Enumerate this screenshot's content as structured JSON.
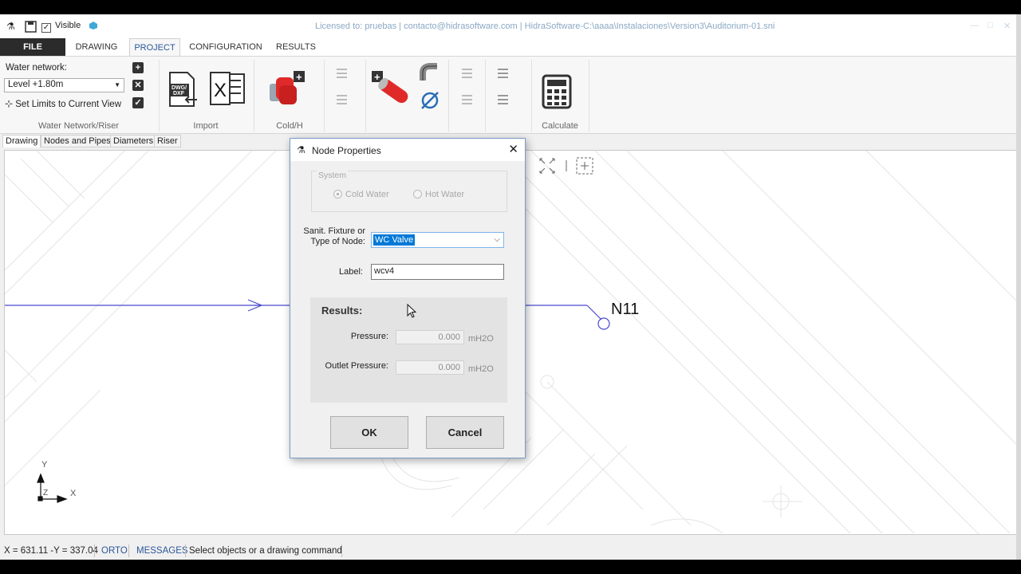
{
  "quick_access": {
    "visible_label": "Visible"
  },
  "window_title": "Licensed to: pruebas | contacto@hidrasoftware.com | HidraSoftware-C:\\aaaa\\Instalaciones\\Version3\\Auditorium-01.sni",
  "tabs": [
    "FILE",
    "DRAWING",
    "PROJECT",
    "CONFIGURATION",
    "RESULTS"
  ],
  "ribbon": {
    "water_network_label": "Water network:",
    "level_value": "Level +1.80m",
    "set_limits_label": "Set Limits to Current View",
    "groups": {
      "water_network_riser": "Water Network/Riser",
      "import": "Import",
      "cold": "Cold/H",
      "calculate": "Calculate"
    },
    "import_icons": {
      "dwg_label": "DWG/DXF",
      "excel_label": "X"
    }
  },
  "drawing_tabs": [
    "Drawing",
    "Nodes and Pipes",
    "Diameters",
    "Riser"
  ],
  "canvas": {
    "node_label": "N11",
    "axis_y": "Y",
    "axis_x": "X",
    "axis_z": "Z"
  },
  "status": {
    "coords": "X = 631.11 -Y = 337.04",
    "orto": "ORTO",
    "messages": "MESSAGES",
    "hint": "Select objects or a drawing command"
  },
  "dialog": {
    "title": "Node Properties",
    "system_legend": "System",
    "cold_water": "Cold Water",
    "hot_water": "Hot Water",
    "fixture_label_1": "Sanit. Fixture or",
    "fixture_label_2": "Type of Node:",
    "fixture_value": "WC Valve",
    "label_label": "Label:",
    "label_value": "wcv4",
    "results_heading": "Results:",
    "pressure_label": "Pressure:",
    "pressure_value": "0.000",
    "pressure_unit": "mH2O",
    "outlet_label": "Outlet Pressure:",
    "outlet_value": "0.000",
    "outlet_unit": "mH2O",
    "ok": "OK",
    "cancel": "Cancel"
  }
}
